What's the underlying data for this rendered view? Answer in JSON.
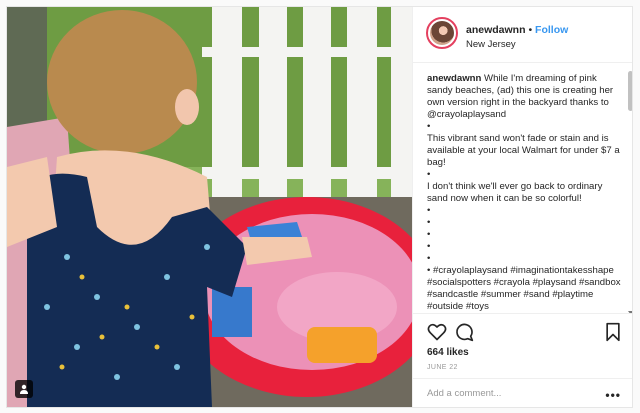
{
  "post": {
    "username": "anewdawnn",
    "separator": "•",
    "follow_label": "Follow",
    "location": "New Jersey",
    "caption_lines": [
      "While I'm dreaming of pink sandy beaches, (ad) this one is creating her own version right in the backyard thanks to @crayolaplaysand",
      "•",
      "This vibrant sand won't fade or stain and is available at your local Walmart for under $7 a bag!",
      "•",
      "I don't think we'll ever go back to ordinary sand now when it can be so colorful!",
      "•",
      "•",
      "•",
      "•",
      "•",
      "• #crayolaplaysand #imaginationtakesshape #socialspotters #crayola #playsand #sandbox #sandcastle #summer #sand #playtime #outside #toys"
    ],
    "likes": "664 likes",
    "date": "JUNE 22",
    "comment_placeholder": "Add a comment...",
    "more_label": "•••"
  },
  "icons": {
    "like": "heart-icon",
    "comment": "comment-icon",
    "save": "bookmark-icon",
    "tag": "person-tag-icon",
    "more": "more-options-icon"
  },
  "colors": {
    "follow": "#3897f0",
    "avatar_ring": "#e4405f",
    "sand": "#e98fb6",
    "table": "#e8213c"
  }
}
